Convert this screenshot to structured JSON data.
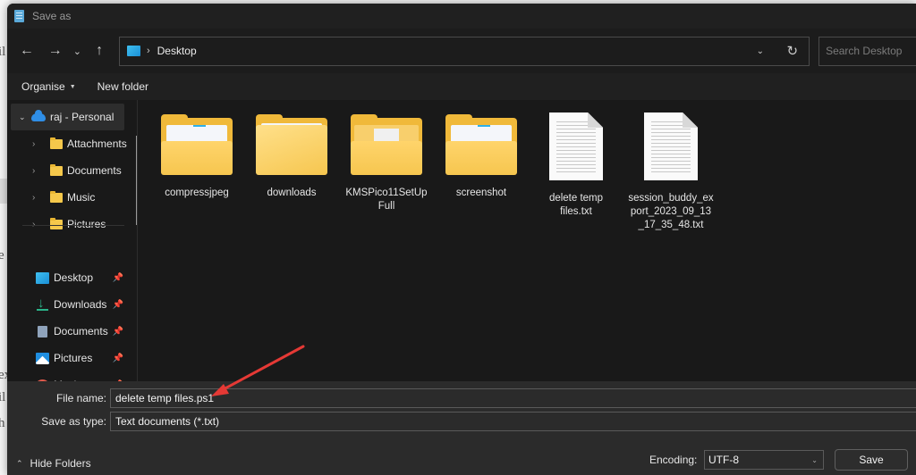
{
  "window": {
    "title": "Save as"
  },
  "navigation": {
    "back_icon": "arrow-left-icon",
    "forward_icon": "arrow-right-icon",
    "recent_icon": "chevron-down-icon",
    "up_icon": "arrow-up-icon",
    "breadcrumb": [
      "Desktop"
    ],
    "refresh_icon": "refresh-icon",
    "search_placeholder": "Search Desktop"
  },
  "commands": {
    "organise": "Organise",
    "new_folder": "New folder"
  },
  "sidebar": {
    "root": {
      "label": "raj - Personal",
      "icon": "onedrive-cloud-icon",
      "expanded": true
    },
    "tree": [
      {
        "label": "Attachments",
        "icon": "folder-icon"
      },
      {
        "label": "Documents",
        "icon": "folder-icon"
      },
      {
        "label": "Music",
        "icon": "folder-icon"
      },
      {
        "label": "Pictures",
        "icon": "folder-icon"
      }
    ],
    "quick_access": [
      {
        "label": "Desktop",
        "icon": "desktop-icon",
        "pinned": true
      },
      {
        "label": "Downloads",
        "icon": "download-icon",
        "pinned": true
      },
      {
        "label": "Documents",
        "icon": "documents-icon",
        "pinned": true
      },
      {
        "label": "Pictures",
        "icon": "pictures-icon",
        "pinned": true
      },
      {
        "label": "Music",
        "icon": "music-icon",
        "pinned": true
      }
    ]
  },
  "files": [
    {
      "name": "compressjpeg",
      "type": "folder"
    },
    {
      "name": "downloads",
      "type": "folder"
    },
    {
      "name": "KMSPico11SetUp Full",
      "type": "folder"
    },
    {
      "name": "screenshot",
      "type": "folder"
    },
    {
      "name": "delete temp files.txt",
      "type": "text-file"
    },
    {
      "name": "session_buddy_export_2023_09_13_17_35_48.txt",
      "type": "text-file"
    }
  ],
  "form": {
    "file_name_label": "File name:",
    "file_name_value": "delete temp files.ps1",
    "save_type_label": "Save as type:",
    "save_type_value": "Text documents (*.txt)",
    "encoding_label": "Encoding:",
    "encoding_value": "UTF-8",
    "save_button": "Save",
    "hide_folders": "Hide Folders"
  },
  "annotation": {
    "arrow_color": "#e53935",
    "points_to": "file-name-input"
  }
}
